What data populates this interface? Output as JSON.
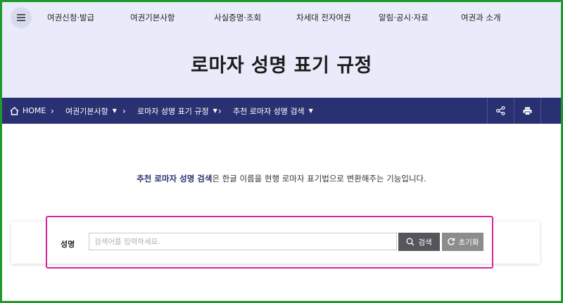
{
  "top_nav": {
    "menu_icon": "hamburger-icon",
    "items": [
      "여권신청·발급",
      "여권기본사항",
      "사실증명·조회",
      "차세대 전자여권",
      "알림·공시·자료",
      "여권과 소개"
    ]
  },
  "hero": {
    "title": "로마자 성명 표기 규정"
  },
  "breadcrumb": {
    "home_icon": "home-icon",
    "home": "HOME",
    "items": [
      "여권기본사항",
      "로마자 성명 표기 규정",
      "추천 로마자 성명 검색"
    ],
    "share_icon": "share-icon",
    "print_icon": "print-icon"
  },
  "intro": {
    "highlight": "추천 로마자 성명 검색",
    "rest": "은 한글 이름을 현행 로마자 표기법으로 변환해주는 기능입니다."
  },
  "search": {
    "label": "성명",
    "placeholder": "검색어를 입력하세요.",
    "search_button": "검색",
    "search_icon": "search-icon",
    "reset_button": "초기화",
    "reset_icon": "refresh-icon"
  },
  "colors": {
    "hero_bg": "#e9ebfa",
    "bar_bg": "#2a3172",
    "search_button": "#55565c",
    "reset_button": "#8c8c8c",
    "highlight_border": "#d6249b",
    "frame_border": "#1f9a2a"
  }
}
